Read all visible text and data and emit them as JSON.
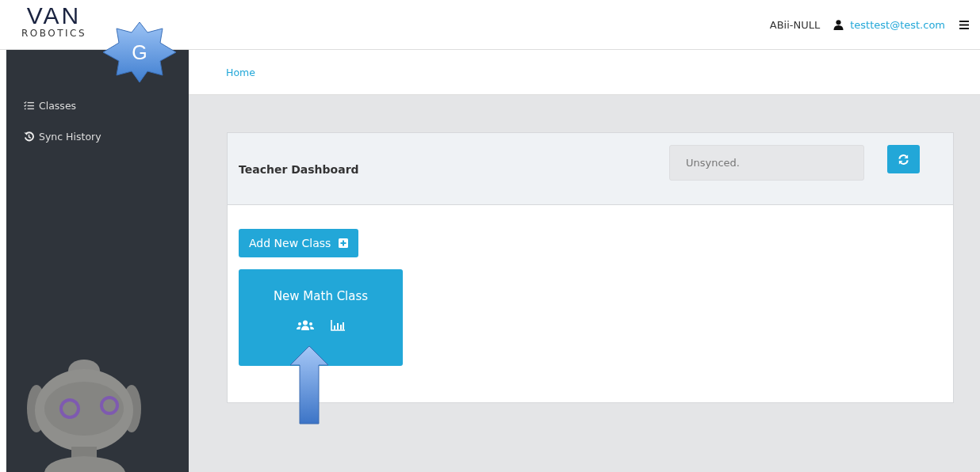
{
  "logo": {
    "mark": "VAN",
    "name": "ROBOTICS"
  },
  "annotation_badge": {
    "label": "G"
  },
  "header": {
    "user_name": "ABii-NULL",
    "email": "testtest@test.com"
  },
  "sidebar": {
    "items": [
      {
        "label": "Classes",
        "kind": "list"
      },
      {
        "label": "Sync History",
        "kind": "history"
      }
    ]
  },
  "breadcrumb": "Home",
  "dashboard": {
    "title": "Teacher Dashboard",
    "sync_status": {
      "placeholder": "Unsynced."
    },
    "add_button": "Add New Class",
    "classes": [
      {
        "name": "New Math Class"
      }
    ]
  }
}
